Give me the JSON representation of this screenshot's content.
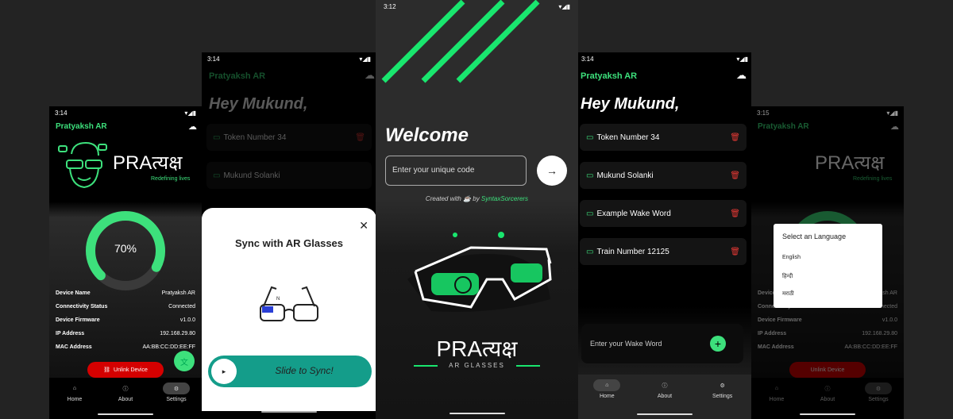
{
  "colors": {
    "accent": "#3de07c",
    "danger": "#e53935",
    "unlink_bg": "#d50000",
    "teal": "#149d8a"
  },
  "status": {
    "time_a": "3:14",
    "time_b": "3:14",
    "time_c": "3:12",
    "time_d": "3:14",
    "time_e": "3:15"
  },
  "app": {
    "name": "Pratyaksh AR",
    "logo_text": "PRAत्यक्ष",
    "tagline": "Redefining lives",
    "sub_brand": "AR GLASSES"
  },
  "battery": {
    "percent_label": "70%",
    "percent": 70
  },
  "device": [
    {
      "k": "Device Name",
      "v": "Pratyaksh AR"
    },
    {
      "k": "Connectivity Status",
      "v": "Connected"
    },
    {
      "k": "Device Firmware",
      "v": "v1.0.0"
    },
    {
      "k": "IP Address",
      "v": "192.168.29.80"
    },
    {
      "k": "MAC Address",
      "v": "AA:BB:CC:DD:EE:FF"
    }
  ],
  "unlink_label": "Unlink Device",
  "nav": {
    "home": "Home",
    "about": "About",
    "settings": "Settings"
  },
  "greeting": "Hey Mukund,",
  "words": [
    "Token Number 34",
    "Mukund Solanki",
    "Example Wake Word",
    "Train Number 12125"
  ],
  "wake_placeholder": "Enter your Wake Word",
  "sync": {
    "title": "Sync with AR Glasses",
    "slide": "Slide to Sync!"
  },
  "welcome": {
    "title": "Welcome",
    "placeholder": "Enter your unique code",
    "created_prefix": "Created with ☕ by",
    "author": "SyntaxSorcerers"
  },
  "language": {
    "title": "Select an Language",
    "options": [
      "English",
      "हिन्दी",
      "मराठी"
    ]
  }
}
